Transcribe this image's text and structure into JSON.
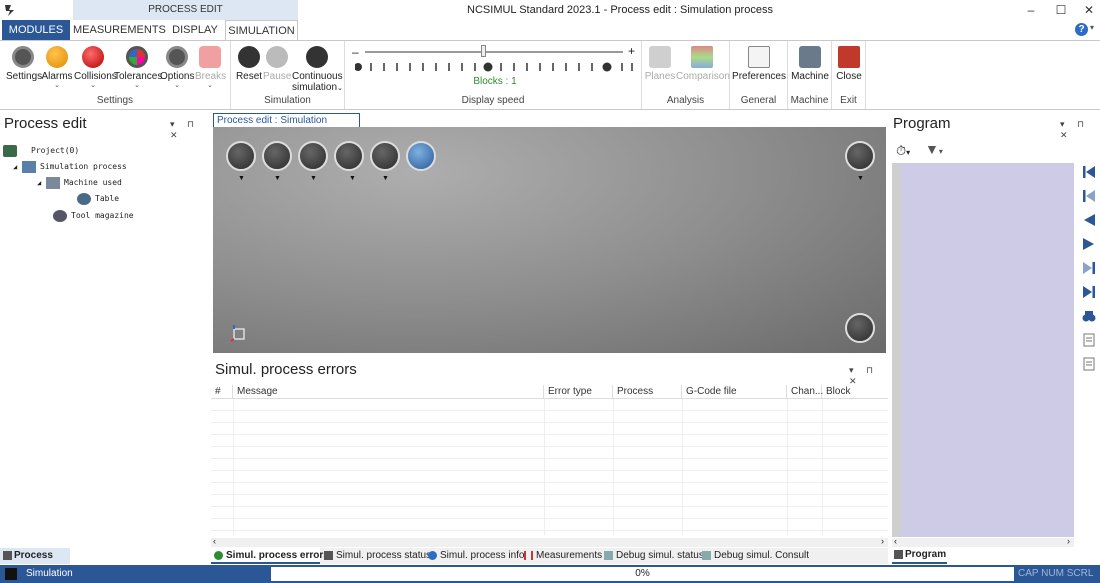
{
  "window": {
    "title": "NCSIMUL Standard 2023.1 - Process edit : Simulation process",
    "context_group": "PROCESS EDIT",
    "minimize": "–",
    "maximize": "☐",
    "close": "✕"
  },
  "ribbon_tabs": [
    "MODULES",
    "MEASUREMENTS",
    "DISPLAY",
    "SIMULATION"
  ],
  "help": "?",
  "ribbon": {
    "settings_group": {
      "label": "Settings",
      "buttons": [
        "Settings",
        "Alarms",
        "Collisions",
        "Tolerances",
        "Options",
        "Breaks"
      ]
    },
    "simulation_group": {
      "label": "Simulation",
      "buttons": [
        "Reset",
        "Pause",
        "Continuous",
        "simulation"
      ]
    },
    "display_speed_group": {
      "label": "Display speed",
      "minus": "–",
      "plus": "+",
      "blocks": "Blocks : 1"
    },
    "analysis_group": {
      "label": "Analysis",
      "buttons": [
        "Planes",
        "Comparison"
      ]
    },
    "general_group": {
      "label": "General",
      "buttons": [
        "Preferences"
      ]
    },
    "machine_group": {
      "label": "Machine",
      "buttons": [
        "Machine"
      ]
    },
    "exit_group": {
      "label": "Exit",
      "buttons": [
        "Close"
      ]
    }
  },
  "left_panel": {
    "title": "Process edit",
    "tree": [
      "Project(0)",
      "Simulation process",
      "Machine used",
      "Table",
      "Tool magazine"
    ],
    "bottom_tab": "Process edit"
  },
  "doc_tab": "Process edit : Simulation process",
  "errors_panel": {
    "title": "Simul. process errors",
    "columns": [
      "#",
      "Message",
      "Error type",
      "Process",
      "G-Code file",
      "Chan...",
      "Block"
    ]
  },
  "bottom_tabs": [
    "Simul. process errors",
    "Simul. process status",
    "Simul. process info",
    "Measurements",
    "Debug simul. status",
    "Debug simul. Consult"
  ],
  "right_panel": {
    "title": "Program",
    "bottom_tab": "Program"
  },
  "status": {
    "text": "Simulation",
    "progress": "0%",
    "keys": "CAP  NUM  SCRL"
  },
  "colors": {
    "accent": "#2b5797",
    "blocks_green": "#2e8b2e",
    "program_list": "#cdcbe6"
  }
}
